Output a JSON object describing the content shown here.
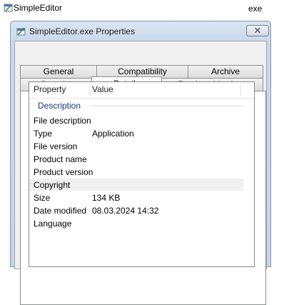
{
  "explorer": {
    "file_name": "SimpleEditor",
    "file_type": "exe"
  },
  "dialog": {
    "title": "SimpleEditor.exe Properties",
    "close_glyph": "✕"
  },
  "tabs": {
    "row1": [
      "General",
      "Compatibility",
      "Archive"
    ],
    "row2": [
      "Security",
      "Details",
      "Previous Versions"
    ],
    "active": "Details"
  },
  "details": {
    "columns": {
      "property": "Property",
      "value": "Value"
    },
    "group": "Description",
    "rows": [
      {
        "name": "File description",
        "value": ""
      },
      {
        "name": "Type",
        "value": "Application"
      },
      {
        "name": "File version",
        "value": ""
      },
      {
        "name": "Product name",
        "value": ""
      },
      {
        "name": "Product version",
        "value": ""
      },
      {
        "name": "Copyright",
        "value": ""
      },
      {
        "name": "Size",
        "value": "134 KB"
      },
      {
        "name": "Date modified",
        "value": "08.03.2024 14:32"
      },
      {
        "name": "Language",
        "value": ""
      }
    ]
  },
  "icons": {
    "file": "exe-file-icon",
    "dialog": "exe-file-icon",
    "close": "close-icon"
  }
}
